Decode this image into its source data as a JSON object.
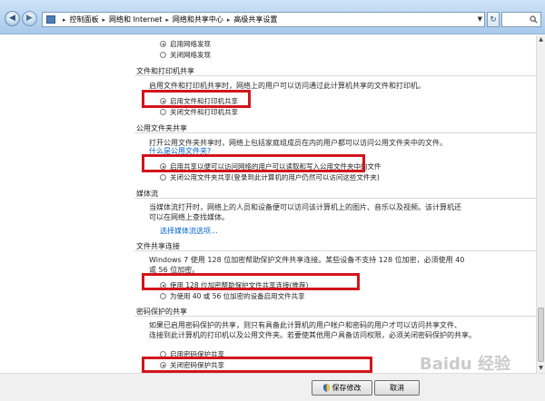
{
  "address": {
    "segments": [
      "控制面板",
      "网络和 Internet",
      "网络和共享中心",
      "高级共享设置"
    ],
    "separator": "▸"
  },
  "sections": {
    "network_discovery": {
      "options": [
        "启用网络发现",
        "关闭网络发现"
      ],
      "selected_index": 0
    },
    "file_printer": {
      "title": "文件和打印机共享",
      "description": "启用文件和打印机共享时，网络上的用户可以访问通过此计算机共享的文件和打印机。",
      "options": [
        "启用文件和打印机共享",
        "关闭文件和打印机共享"
      ],
      "selected_index": 0
    },
    "public_folder": {
      "title": "公用文件夹共享",
      "description_line1": "打开公用文件夹共享时，网络上包括家庭组成员在内的用户都可以访问公用文件夹中的文件。",
      "link": "什么是公用文件夹?",
      "options": [
        "启用共享以便可以访问网络的用户可以读取和写入公用文件夹中的文件",
        "关闭公用文件夹共享(登录到此计算机的用户仍然可以访问这些文件夹)"
      ],
      "selected_index": 0
    },
    "media_streaming": {
      "title": "媒体流",
      "description_line1": "当媒体流打开时，网络上的人员和设备便可以访问该计算机上的图片、音乐以及视频。该计算机还",
      "description_line2": "可以在网络上查找媒体。",
      "link": "选择媒体流选项..."
    },
    "file_sharing_connections": {
      "title": "文件共享连接",
      "description_line1": "Windows 7 使用 128 位加密帮助保护文件共享连接。某些设备不支持 128 位加密，必须使用 40",
      "description_line2": "或 56 位加密。",
      "options": [
        "使用 128 位加密帮助保护文件共享连接(推荐)",
        "为使用 40 或 56 位加密的设备启用文件共享"
      ],
      "selected_index": 0
    },
    "password_protected": {
      "title": "密码保护的共享",
      "description_line1": "如果已启用密码保护的共享，则只有具备此计算机的用户帐户和密码的用户才可以访问共享文件、",
      "description_line2": "连接到此计算机的打印机以及公用文件夹。若要使其他用户具备访问权限，必须关闭密码保护的共享。",
      "options": [
        "启用密码保护共享",
        "关闭密码保护共享"
      ],
      "selected_index": 1
    }
  },
  "buttons": {
    "save": "保存修改",
    "cancel": "取消"
  },
  "watermark": "Baidu 经验",
  "colors": {
    "highlight_box": "#d4141c",
    "link": "#0066cc",
    "titlebar": "#b9d5f1"
  }
}
